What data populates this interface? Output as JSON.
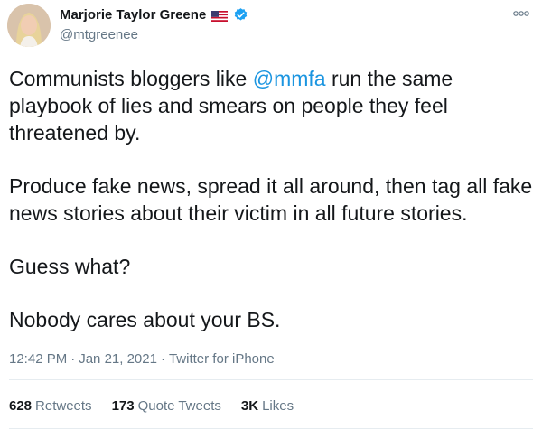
{
  "author": {
    "display_name": "Marjorie Taylor Greene",
    "handle": "@mtgreenee",
    "flag_icon": "us-flag-icon",
    "verified_icon": "verified-badge-icon",
    "brand_color": "#1da1f2"
  },
  "tweet": {
    "p1_before": "Communists bloggers like ",
    "p1_mention": "@mmfa",
    "p1_after": " run the same playbook of lies and smears on people they feel threatened by.",
    "p2": "Produce fake news, spread it all around, then tag all fake news stories about their victim in all future stories.",
    "p3": "Guess what?",
    "p4": "Nobody cares about your BS."
  },
  "meta": {
    "time": "12:42 PM",
    "separator1": "·",
    "date": "Jan 21, 2021",
    "separator2": "·",
    "source": "Twitter for iPhone"
  },
  "stats": {
    "retweets_count": "628",
    "retweets_label": "Retweets",
    "quote_count": "173",
    "quote_label": "Quote Tweets",
    "likes_count": "3K",
    "likes_label": "Likes"
  }
}
